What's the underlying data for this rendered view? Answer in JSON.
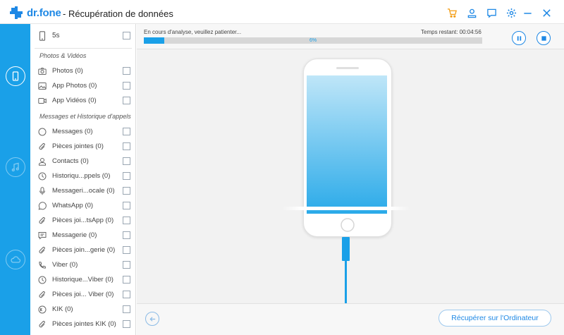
{
  "app": {
    "brand": "dr.fone",
    "title": "- Récupération de données",
    "colors": {
      "accent": "#1aa0e8",
      "cart": "#f39c12",
      "rail": "#1aa0e8"
    }
  },
  "titlebar_icons": [
    "cart-icon",
    "account-icon",
    "feedback-icon",
    "settings-icon",
    "minimize-icon",
    "close-icon"
  ],
  "sidebar": {
    "device": {
      "label": "5s"
    },
    "groups": [
      {
        "title": "Photos & Vidéos",
        "items": [
          {
            "label": "Photos (0)",
            "icon": "camera-icon"
          },
          {
            "label": "App Photos (0)",
            "icon": "image-icon"
          },
          {
            "label": "App Vidéos (0)",
            "icon": "video-icon"
          }
        ]
      },
      {
        "title": "Messages et Historique d'appels",
        "items": [
          {
            "label": "Messages (0)",
            "icon": "message-icon"
          },
          {
            "label": "Pièces jointes (0)",
            "icon": "paperclip-icon"
          },
          {
            "label": "Contacts (0)",
            "icon": "contact-icon"
          },
          {
            "label": "Historiqu...ppels (0)",
            "icon": "clock-icon"
          },
          {
            "label": "Messageri...ocale (0)",
            "icon": "microphone-icon"
          },
          {
            "label": "WhatsApp (0)",
            "icon": "whatsapp-icon"
          },
          {
            "label": "Pièces joi...tsApp (0)",
            "icon": "paperclip-icon"
          },
          {
            "label": "Messagerie (0)",
            "icon": "chat-icon"
          },
          {
            "label": "Pièces join...gerie  (0)",
            "icon": "paperclip-icon"
          },
          {
            "label": "Viber (0)",
            "icon": "phone-icon"
          },
          {
            "label": "Historique...Viber (0)",
            "icon": "clock-icon"
          },
          {
            "label": "Pièces joi... Viber (0)",
            "icon": "paperclip-icon"
          },
          {
            "label": "KIK (0)",
            "icon": "kik-icon"
          },
          {
            "label": "Pièces jointes KIK (0)",
            "icon": "paperclip-icon"
          }
        ]
      }
    ]
  },
  "scan": {
    "status": "En cours d'analyse, veuillez patienter...",
    "remaining": "Temps restant: 00:04:56",
    "progress_label": "6%",
    "progress_value": 0.06
  },
  "footer": {
    "recover_label": "Récupérer sur l'Ordinateur"
  }
}
